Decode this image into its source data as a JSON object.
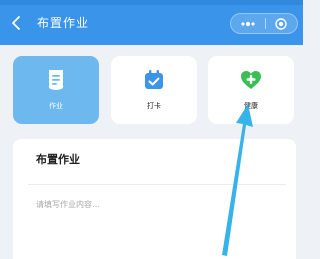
{
  "header": {
    "title": "布置作业",
    "icons": {
      "back": "chevron-left-icon",
      "more": "more-dots-icon",
      "close": "target-circle-icon"
    }
  },
  "tiles": [
    {
      "label": "作业",
      "icon": "homework-doc-icon",
      "selected": true
    },
    {
      "label": "打卡",
      "icon": "calendar-check-icon",
      "selected": false
    },
    {
      "label": "健康",
      "icon": "heart-plus-icon",
      "selected": false
    }
  ],
  "form": {
    "title": "布置作业",
    "content_placeholder": "请填写作业内容…"
  },
  "colors": {
    "header": "#3a94ea",
    "active_tile": "#6db8ef",
    "calendar_icon": "#3b95e8",
    "health_icon": "#3bbf55",
    "annotation_arrow": "#35b3ea"
  }
}
